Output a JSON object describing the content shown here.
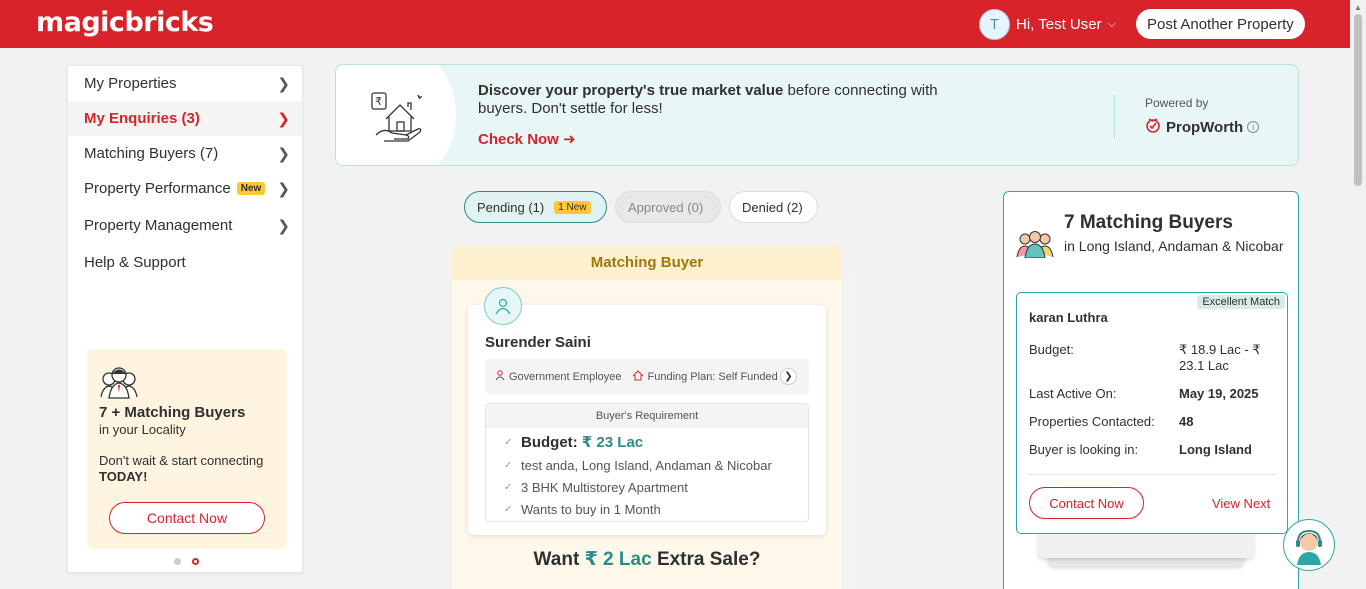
{
  "header": {
    "logo": "magicbricks",
    "avatar_letter": "T",
    "greeting": "Hi, Test User",
    "post_button": "Post Another Property"
  },
  "sidebar": {
    "items": [
      {
        "label": "My Properties"
      },
      {
        "label": "My Enquiries (3)",
        "active": true
      },
      {
        "label": "Matching Buyers (7)"
      },
      {
        "label": "Property Performance",
        "badge": "New"
      },
      {
        "label": "Property Management"
      },
      {
        "label": "Help & Support"
      }
    ],
    "promo": {
      "title": "7 + Matching Buyers",
      "subtitle": "in your Locality",
      "text": "Don't wait & start connecting",
      "text_bold": "TODAY!",
      "button": "Contact Now"
    }
  },
  "banner": {
    "headline_bold": "Discover your property's true market value",
    "headline_rest": " before connecting with buyers. Don't settle for less!",
    "cta": "Check Now",
    "powered_by": "Powered by",
    "brand": "PropWorth"
  },
  "tabs": {
    "pending": "Pending (1)",
    "pending_badge": "1 New",
    "approved": "Approved (0)",
    "denied": "Denied (2)"
  },
  "matching_buyer": {
    "header": "Matching Buyer",
    "name": "Surender Saini",
    "tags": [
      "Government Employee",
      "Funding Plan: Self Funded"
    ],
    "requirement_title": "Buyer's Requirement",
    "budget_label": "Budget:",
    "budget_value": "₹ 23 Lac",
    "requirements": [
      "test anda, Long Island, Andaman & Nicobar",
      "3 BHK Multistorey Apartment",
      "Wants to buy in 1 Month"
    ],
    "want_prefix": "Want",
    "want_value": "₹ 2 Lac",
    "want_suffix": "Extra Sale?"
  },
  "right_panel": {
    "title": "7 Matching Buyers",
    "subtitle": "in Long Island, Andaman & Nicobar",
    "card": {
      "badge": "Excellent Match",
      "name": "karan Luthra",
      "rows": [
        {
          "label": "Budget:",
          "value": "₹ 18.9 Lac - ₹ 23.1 Lac"
        },
        {
          "label": "Last Active On:",
          "value": "May 19, 2025"
        },
        {
          "label": "Properties Contacted:",
          "value": "48"
        },
        {
          "label": "Buyer is looking in:",
          "value": "Long Island"
        }
      ],
      "contact_button": "Contact Now",
      "view_next": "View Next"
    }
  },
  "colors": {
    "brand_red": "#d8232a",
    "teal": "#2c8b86",
    "gold": "#a0770c"
  }
}
